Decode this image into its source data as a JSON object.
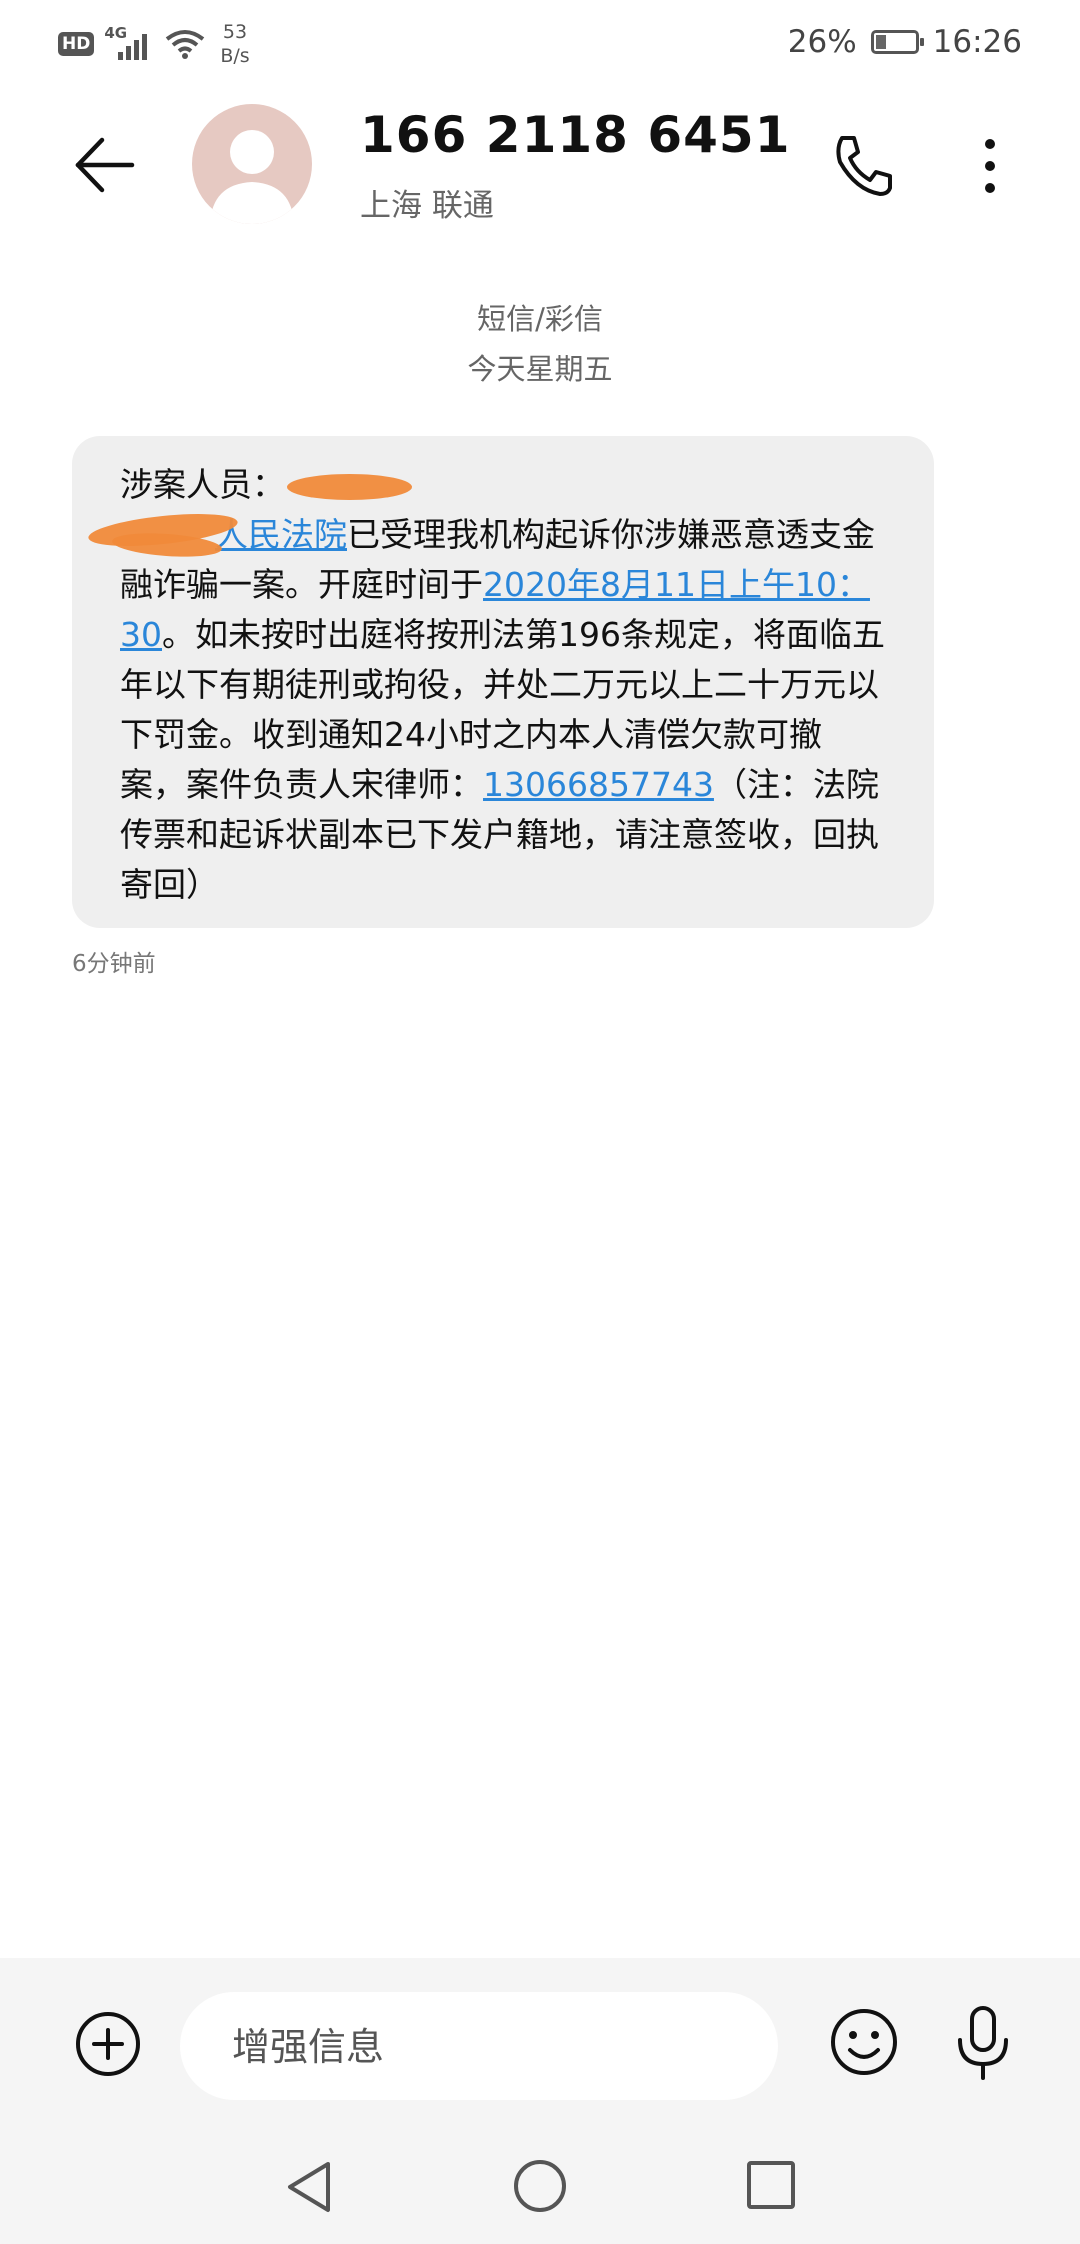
{
  "status_bar": {
    "hd": "HD",
    "network": "4G",
    "speed_value": "53",
    "speed_unit": "B/s",
    "battery_percent": "26%",
    "battery_level": 0.26,
    "time": "16:26"
  },
  "header": {
    "contact_number": "166 2118 6451",
    "carrier": "上海 联通",
    "icons": [
      "back-arrow-icon",
      "avatar-person-icon",
      "phone-call-icon",
      "more-vertical-icon"
    ]
  },
  "conversation": {
    "type_label": "短信/彩信",
    "date_label": "今天星期五"
  },
  "message": {
    "line1": "涉案人员：",
    "court_link": "人民法院",
    "text_a": "已受理我机构起诉你涉嫌恶意透支金融诈骗一案。开庭时间于",
    "date_link": "2020年8月11日上午10：30",
    "text_b": "。如未按时出庭将按刑法第196条规定，将面临五年以下有期徒刑或拘役，并处二万元以上二十万元以下罚金。收到通知24小时之内本人清偿欠款可撤案，案件负责人宋律师：",
    "phone_link": "13066857743",
    "text_c": "（注：法院传票和起诉状副本已下发户籍地，请注意签收，回执寄回）",
    "time": "6分钟前"
  },
  "compose": {
    "placeholder": "增强信息",
    "icons": [
      "add-circle-icon",
      "emoji-icon",
      "microphone-icon"
    ]
  },
  "colors": {
    "link": "#2a86d9",
    "bubble": "#efefef",
    "redaction": "#f08a3a",
    "compose_bg": "#f5f5f5"
  }
}
